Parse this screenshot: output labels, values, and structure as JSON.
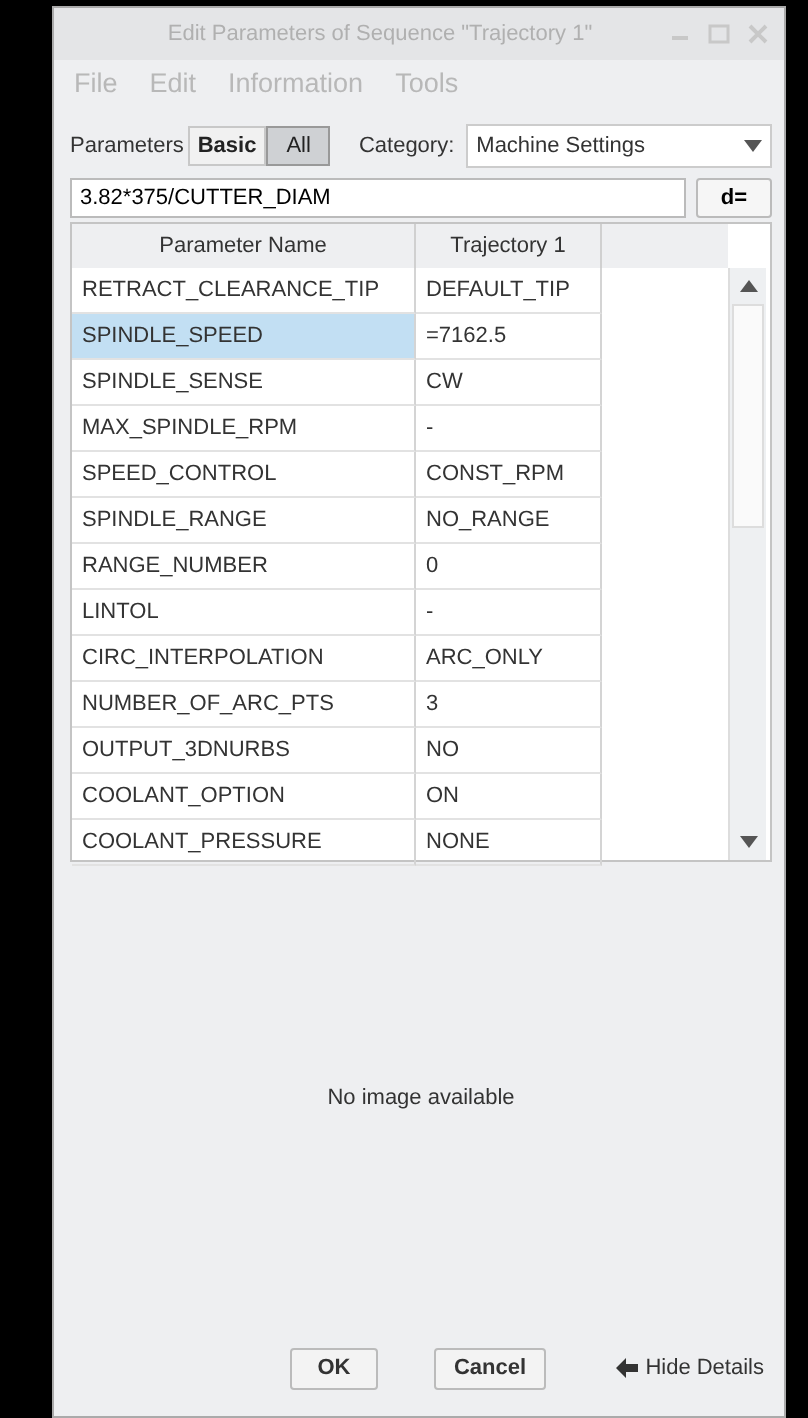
{
  "window": {
    "title": "Edit Parameters of Sequence \"Trajectory 1\""
  },
  "menu": [
    {
      "label": "File",
      "disabled": true
    },
    {
      "label": "Edit",
      "disabled": true
    },
    {
      "label": "Information",
      "disabled": true
    },
    {
      "label": "Tools",
      "disabled": true
    }
  ],
  "parameters_label": "Parameters",
  "filter_buttons": [
    {
      "label": "Basic",
      "selected": false
    },
    {
      "label": "All",
      "selected": true
    }
  ],
  "category": {
    "label": "Category:",
    "value": "Machine Settings"
  },
  "formula": {
    "value": "3.82*375/CUTTER_DIAM"
  },
  "d_button": "d=",
  "table": {
    "columns": [
      "Parameter Name",
      "Trajectory 1"
    ],
    "rows": [
      {
        "name": "RETRACT_CLEARANCE_TIP",
        "value": "DEFAULT_TIP",
        "selected": false
      },
      {
        "name": "SPINDLE_SPEED",
        "value": "=7162.5",
        "selected": true
      },
      {
        "name": "SPINDLE_SENSE",
        "value": "CW",
        "selected": false
      },
      {
        "name": "MAX_SPINDLE_RPM",
        "value": "-",
        "selected": false
      },
      {
        "name": "SPEED_CONTROL",
        "value": "CONST_RPM",
        "selected": false
      },
      {
        "name": "SPINDLE_RANGE",
        "value": "NO_RANGE",
        "selected": false
      },
      {
        "name": "RANGE_NUMBER",
        "value": "0",
        "selected": false
      },
      {
        "name": "LINTOL",
        "value": "-",
        "selected": false
      },
      {
        "name": "CIRC_INTERPOLATION",
        "value": "ARC_ONLY",
        "selected": false
      },
      {
        "name": "NUMBER_OF_ARC_PTS",
        "value": "3",
        "selected": false
      },
      {
        "name": "OUTPUT_3DNURBS",
        "value": "NO",
        "selected": false
      },
      {
        "name": "COOLANT_OPTION",
        "value": "ON",
        "selected": false
      },
      {
        "name": "COOLANT_PRESSURE",
        "value": "NONE",
        "selected": false
      }
    ]
  },
  "image_message": "No image available",
  "buttons": [
    "OK",
    "Cancel"
  ],
  "hide_details": "Hide Details"
}
